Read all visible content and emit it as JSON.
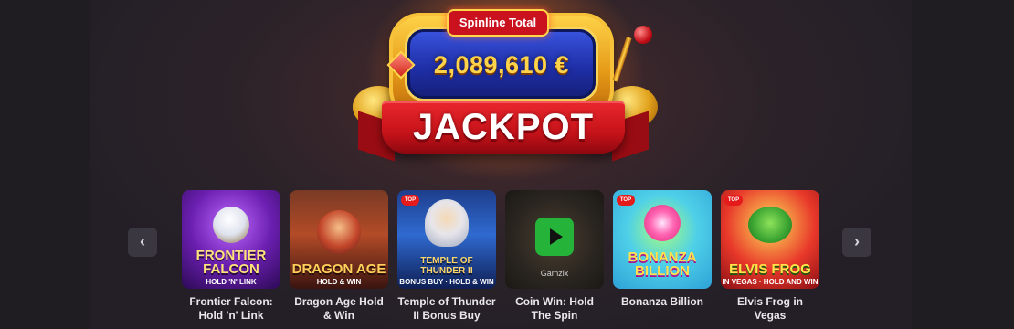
{
  "jackpot": {
    "total_label": "Spinline Total",
    "amount": "2,089,610 €",
    "title": "JACKPOT"
  },
  "carousel": {
    "prev_icon": "chevron-left-icon",
    "next_icon": "chevron-right-icon",
    "prev_glyph": "‹",
    "next_glyph": "›",
    "games": [
      {
        "title": "Frontier Falcon: Hold 'n' Link",
        "thumb_line1": "FRONTIER FALCON",
        "thumb_line2": "HOLD 'N' LINK",
        "badge": ""
      },
      {
        "title": "Dragon Age Hold & Win",
        "thumb_line1": "DRAGON AGE",
        "thumb_line2": "HOLD & WIN",
        "badge": ""
      },
      {
        "title": "Temple of Thunder II Bonus Buy",
        "thumb_line1": "TEMPLE OF THUNDER II",
        "thumb_line2": "BONUS BUY · HOLD & WIN",
        "badge": "TOP"
      },
      {
        "title": "Coin Win: Hold The Spin",
        "thumb_line1": "",
        "thumb_line2": "",
        "badge": "",
        "provider": "Gamzix"
      },
      {
        "title": "Bonanza Billion",
        "thumb_line1": "BONANZA BILLION",
        "thumb_line2": "",
        "badge": "TOP"
      },
      {
        "title": "Elvis Frog in Vegas",
        "thumb_line1": "ELVIS FROG",
        "thumb_line2": "IN VEGAS · HOLD AND WIN",
        "badge": "TOP"
      }
    ]
  },
  "colors": {
    "background": "#1e1c22",
    "accent_red": "#c9121e",
    "accent_gold": "#ffd34a",
    "play_green": "#26b33a"
  }
}
